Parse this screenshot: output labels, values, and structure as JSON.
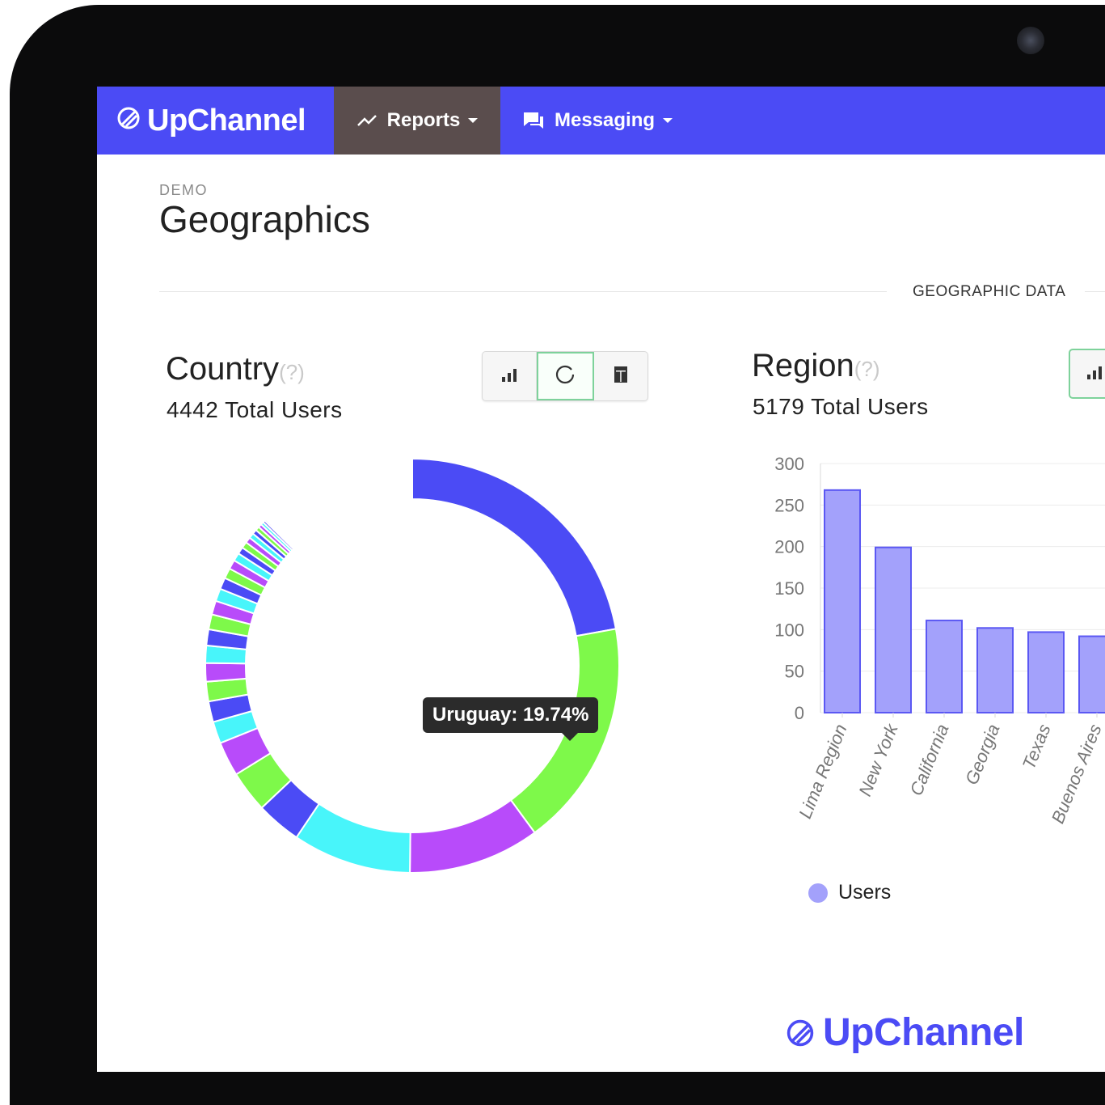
{
  "nav": {
    "brand": "UpChannel",
    "items": [
      {
        "label": "Reports",
        "icon": "trend-line-icon",
        "active": true
      },
      {
        "label": "Messaging",
        "icon": "chat-icon",
        "active": false
      }
    ]
  },
  "page": {
    "eyebrow": "DEMO",
    "title": "Geographics",
    "section_label": "GEOGRAPHIC DATA"
  },
  "country_card": {
    "title": "Country",
    "help": "(?)",
    "subtitle": "4442 Total Users",
    "view_buttons": [
      "bar-chart-icon",
      "donut-chart-icon",
      "table-icon"
    ],
    "active_view": "donut-chart-icon",
    "tooltip": "Uruguay: 19.74%"
  },
  "region_card": {
    "title": "Region",
    "help": "(?)",
    "subtitle": "5179 Total Users",
    "legend_label": "Users"
  },
  "footer": {
    "brand": "UpChannel"
  },
  "colors": {
    "brand": "#4b4bf5",
    "active_nav": "#5a4d4d",
    "bar_fill": "#a3a1fb",
    "bar_stroke": "#5b58f3",
    "donut": [
      "#4b4bf5",
      "#7ef94a",
      "#b84bfa",
      "#48f5fa"
    ]
  },
  "chart_data": [
    {
      "type": "pie",
      "subtype": "donut",
      "segments": [
        {
          "name": "",
          "value": 24.6,
          "color": "#4b4bf5"
        },
        {
          "name": "Uruguay",
          "value": 19.74,
          "color": "#7ef94a"
        },
        {
          "name": "",
          "value": 11.4,
          "color": "#b84bfa"
        },
        {
          "name": "",
          "value": 10.3,
          "color": "#48f5fa"
        },
        {
          "name": "",
          "value": 3.9,
          "color": "#4b4bf5"
        },
        {
          "name": "",
          "value": 3.6,
          "color": "#7ef94a"
        },
        {
          "name": "",
          "value": 3.0,
          "color": "#b84bfa"
        },
        {
          "name": "",
          "value": 1.9,
          "color": "#48f5fa"
        },
        {
          "name": "",
          "value": 1.8,
          "color": "#4b4bf5"
        },
        {
          "name": "",
          "value": 1.7,
          "color": "#7ef94a"
        },
        {
          "name": "",
          "value": 1.6,
          "color": "#b84bfa"
        },
        {
          "name": "",
          "value": 1.5,
          "color": "#48f5fa"
        },
        {
          "name": "",
          "value": 1.4,
          "color": "#4b4bf5"
        },
        {
          "name": "",
          "value": 1.3,
          "color": "#7ef94a"
        },
        {
          "name": "",
          "value": 1.2,
          "color": "#b84bfa"
        },
        {
          "name": "",
          "value": 1.1,
          "color": "#48f5fa"
        },
        {
          "name": "",
          "value": 1.0,
          "color": "#4b4bf5"
        },
        {
          "name": "",
          "value": 0.9,
          "color": "#7ef94a"
        },
        {
          "name": "",
          "value": 0.8,
          "color": "#b84bfa"
        },
        {
          "name": "",
          "value": 0.7,
          "color": "#48f5fa"
        },
        {
          "name": "",
          "value": 0.6,
          "color": "#4b4bf5"
        },
        {
          "name": "",
          "value": 0.55,
          "color": "#7ef94a"
        },
        {
          "name": "",
          "value": 0.5,
          "color": "#b84bfa"
        },
        {
          "name": "",
          "value": 0.45,
          "color": "#48f5fa"
        },
        {
          "name": "",
          "value": 0.4,
          "color": "#4b4bf5"
        },
        {
          "name": "",
          "value": 0.35,
          "color": "#7ef94a"
        },
        {
          "name": "",
          "value": 0.3,
          "color": "#b84bfa"
        },
        {
          "name": "",
          "value": 0.25,
          "color": "#48f5fa"
        },
        {
          "name": "",
          "value": 0.2,
          "color": "#4b4bf5"
        },
        {
          "name": "",
          "value": 0.15,
          "color": "#b84bfa"
        }
      ],
      "gap_degrees": 45
    },
    {
      "type": "bar",
      "categories": [
        "Lima Region",
        "New York",
        "California",
        "Georgia",
        "Texas",
        "Buenos Aires"
      ],
      "series": [
        {
          "name": "Users",
          "values": [
            268,
            199,
            111,
            102,
            97,
            92
          ]
        }
      ],
      "ylim": [
        0,
        300
      ],
      "yticks": [
        0,
        50,
        100,
        150,
        200,
        250,
        300
      ],
      "grid": true,
      "legend": "bottom-left"
    }
  ]
}
